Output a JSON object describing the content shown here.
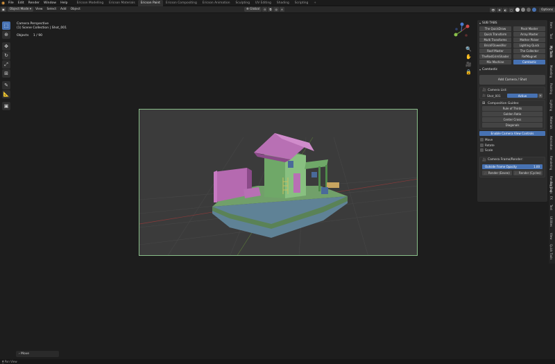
{
  "menubar": {
    "menus": [
      "File",
      "Edit",
      "Render",
      "Window",
      "Help"
    ],
    "workspaces": [
      "Ericson Modelling",
      "Ericson Materials",
      "Ericson Paint",
      "Ericson Compositing",
      "Ericson Animation",
      "Sculpting",
      "UV Editing",
      "Shading",
      "Scripting"
    ],
    "active_workspace": "Ericson Paint",
    "options_label": "Options"
  },
  "toolbar": {
    "mode": "Object Mode",
    "menus": [
      "View",
      "Select",
      "Add",
      "Object"
    ],
    "transform_orientation": "Global"
  },
  "viewport": {
    "view_name": "Camera Perspective",
    "collection_path": "(1) Scene Collection | Shot_001",
    "objects_label": "Objects",
    "objects_count": "1 / 90"
  },
  "subtabs": {
    "header": "SUB TABS",
    "buttons": [
      {
        "label": "The QuickDraw",
        "active": false
      },
      {
        "label": "Pivot Master",
        "active": false
      },
      {
        "label": "Quick Transform",
        "active": false
      },
      {
        "label": "Array Master",
        "active": false
      },
      {
        "label": "Multi Transforms",
        "active": false
      },
      {
        "label": "Mother Picker",
        "active": false
      },
      {
        "label": "BrickFDowel/Ilsr",
        "active": false
      },
      {
        "label": "Lighting Quick",
        "active": false
      },
      {
        "label": "Roof Master",
        "active": false
      },
      {
        "label": "The Collector",
        "active": false
      },
      {
        "label": "TheRedGrimShader",
        "active": false
      },
      {
        "label": "RefMagnet",
        "active": false
      },
      {
        "label": "Mix Machine",
        "active": false
      },
      {
        "label": "Camtastic",
        "active": true
      }
    ]
  },
  "camtastic": {
    "header": "Camtastic",
    "add_button": "Add Camera / Shot",
    "camera_list_label": "Camera List:",
    "camera_item": "Shot_001",
    "camera_state": "Active",
    "guides_label": "Composition Guides:",
    "guides": [
      "Rule of Thirds",
      "Golden Ratio",
      "Center Cross",
      "Diagonals"
    ],
    "enable_controls": "Enable Camera View Controls",
    "checkboxes": [
      "Move",
      "Rotate",
      "Scale"
    ],
    "frame_render_label": "Camera Frame/Render:",
    "opacity_label": "Outside Frame Opacity",
    "opacity_value": "1.00",
    "render_eevee": "Render (Eevee)",
    "render_cycles": "Render (Cycles)"
  },
  "sidebar_tabs": [
    "Item",
    "Tool",
    "My Tools",
    "Modeling",
    "Painting",
    "Lighting",
    "Materials",
    "Animation",
    "Rendering",
    "Render Tools",
    "Rigging",
    "FX",
    "Text",
    "Utilities",
    "View",
    "Quick Tools"
  ],
  "active_sidebar_tab": "My Tools",
  "last_operator": "Move",
  "status_hint": "Pan View",
  "colors": {
    "accent": "#4772b3",
    "camera_frame": "#8ac08a",
    "house_roof": "#b06ab0",
    "house_wall": "#6ab06a",
    "boat_hull": "#6a8aa0"
  }
}
